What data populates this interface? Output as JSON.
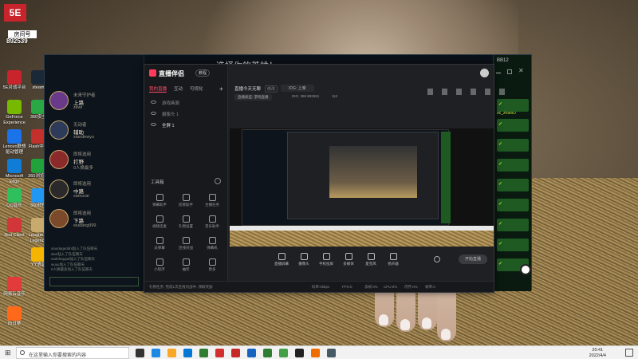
{
  "desktop": {
    "icons": [
      {
        "label": "5E对战平台",
        "color": "#c9242b",
        "col": 0,
        "row": 0
      },
      {
        "label": "GeForce Experience",
        "color": "#76b900",
        "col": 0,
        "row": 1
      },
      {
        "label": "Lenovo联想 驱动管理",
        "color": "#1a73e8",
        "col": 0,
        "row": 2
      },
      {
        "label": "Microsoft Edge",
        "color": "#0f7cd6",
        "col": 0,
        "row": 3
      },
      {
        "label": "QQ音乐",
        "color": "#2fbf5c",
        "col": 0,
        "row": 4
      },
      {
        "label": "Riot Client",
        "color": "#d13639",
        "col": 0,
        "row": 5
      },
      {
        "label": "网易云音乐",
        "color": "#e23b3b",
        "col": 0,
        "row": 7
      },
      {
        "label": "向日葵",
        "color": "#ff6a1a",
        "col": 0,
        "row": 8
      },
      {
        "label": "steam",
        "color": "#1b2838",
        "col": 1,
        "row": 0
      },
      {
        "label": "360安全",
        "color": "#2aa845",
        "col": 1,
        "row": 1
      },
      {
        "label": "Flash中心",
        "color": "#c4302b",
        "col": 1,
        "row": 2
      },
      {
        "label": "360浏览器",
        "color": "#21a33b",
        "col": 1,
        "row": 3
      },
      {
        "label": "360软件",
        "color": "#2196f3",
        "col": 1,
        "row": 4
      },
      {
        "label": "League of Legends",
        "color": "#c8aa6e",
        "col": 1,
        "row": 5
      },
      {
        "label": "YY语音",
        "color": "#f5b400",
        "col": 1,
        "row": 6
      }
    ],
    "room_label": "房间号",
    "room_number": "892539"
  },
  "lol_client": {
    "title": "选择你的英雄！",
    "champions": [
      {
        "name": "上路",
        "line1": "未来守护者",
        "line2": "zkwt",
        "color": "#6a3a8a"
      },
      {
        "name": "辅助",
        "line1": "无动者",
        "line2": "xiaodewyu",
        "color": "#2d3a5a"
      },
      {
        "name": "打野",
        "line1": "即将选用",
        "line2": "0人换最多",
        "color": "#8a2a2a"
      },
      {
        "name": "中路",
        "line1": "即将选用",
        "line2": "samurai",
        "color": "#2a2a2a"
      },
      {
        "name": "下路",
        "line1": "即将选用",
        "line2": "wudang999",
        "color": "#7a4a2a"
      }
    ],
    "chat_lines": [
      "xiaodegedahi加入了队伍聊天",
      "dwe钻入了队伍聊天",
      "sadefaqqad加入了队伍聊天",
      "wuyu加入了队伍聊天",
      "0人换最多加入了队伍聊天"
    ],
    "right_label": "BB12",
    "right_name": "dc_zhaolO"
  },
  "stream_app": {
    "brand": "直播伴侣",
    "badge": "教程",
    "tabs": [
      "我的直播",
      "互动",
      "可视化"
    ],
    "scene_rows": [
      "游戏画面",
      "摄像头 1",
      "全屏 1"
    ],
    "tools_title": "工具箱",
    "tools": [
      "弹幕助手",
      "房管助手",
      "主播任务",
      "视频连麦",
      "礼物设置",
      "音乐助手",
      "派弹幕",
      "连线对战",
      "弹幕机",
      "小程序",
      "抽奖",
      "更多"
    ],
    "room_title": "直播今天无聊",
    "edit_label": "修改",
    "room_id": "IDG: 上席",
    "category_label": "直播类型: 游戏直播",
    "stats_id": "IDG: 386  892581",
    "stats_fans": "112",
    "bottom_buttons": [
      "直播屏幕",
      "摄像头",
      "手机投屏",
      "多媒体",
      "麦克风",
      "扬声器"
    ],
    "start_label": "开始直播",
    "status_items": [
      "礼物任务: 完成1次连线对战中, 领取奖励",
      "码率:0kbps",
      "FPS:0",
      "丢帧:0%",
      "CPU:0%",
      "内存:0%",
      "帧率:0"
    ]
  },
  "taskbar": {
    "search_placeholder": "在这里输入你要搜索的内容",
    "time": "20:41",
    "date": "2022/4/4",
    "icon_colors": [
      "#333",
      "#1e88e5",
      "#f9a825",
      "#0078d4",
      "#2e7d32",
      "#d32f2f",
      "#c62828",
      "#1565c0",
      "#2e7d32",
      "#43a047",
      "#212121",
      "#ef6c00",
      "#455a64"
    ]
  }
}
